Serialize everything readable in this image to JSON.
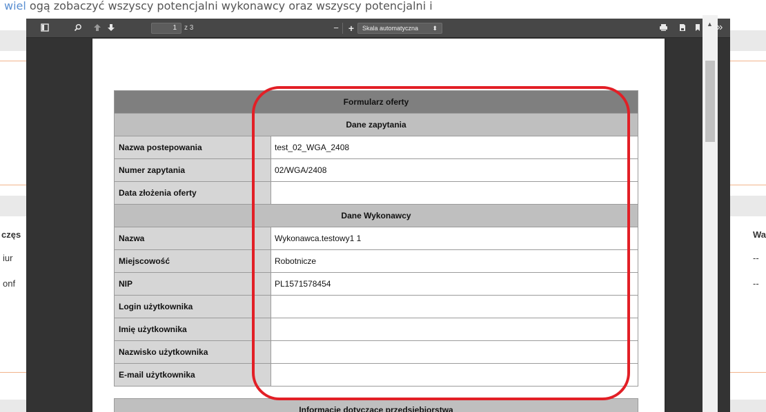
{
  "background": {
    "top_text_link": "wiel",
    "top_text": "ogą zobaczyć wszyscy potencjalni wykonawcy oraz wszyscy potencjalni i",
    "left_col": [
      "częs",
      "iur",
      "onf"
    ],
    "right_col": [
      "Wa",
      "--",
      "--"
    ]
  },
  "toolbar": {
    "page_value": "1",
    "page_of": "z 3",
    "zoom_label": "Skala automatyczna",
    "zoom_arrow": "⬍",
    "zoom_minus": "−",
    "zoom_plus": "+",
    "more": "»"
  },
  "form": {
    "title": "Formularz oferty",
    "sections": [
      {
        "header": "Dane zapytania",
        "rows": [
          {
            "label": "Nazwa postepowania",
            "value": "test_02_WGA_2408"
          },
          {
            "label": "Numer zapytania",
            "value": "02/WGA/2408"
          },
          {
            "label": "Data złożenia oferty",
            "value": ""
          }
        ]
      },
      {
        "header": "Dane Wykonawcy",
        "rows": [
          {
            "label": "Nazwa",
            "value": "Wykonawca.testowy1 1"
          },
          {
            "label": "Miejscowość",
            "value": "Robotnicze"
          },
          {
            "label": "NIP",
            "value": "PL1571578454"
          },
          {
            "label": "Login użytkownika",
            "value": ""
          },
          {
            "label": "Imię użytkownika",
            "value": ""
          },
          {
            "label": "Nazwisko użytkownika",
            "value": ""
          },
          {
            "label": "E-mail użytkownika",
            "value": ""
          }
        ]
      },
      {
        "header": "Informacje dotyczące przedsiębiorstwa",
        "rows": []
      }
    ]
  },
  "colors": {
    "highlight": "#e21f26",
    "toolbar": "#474747",
    "viewer_bg": "#333333"
  }
}
